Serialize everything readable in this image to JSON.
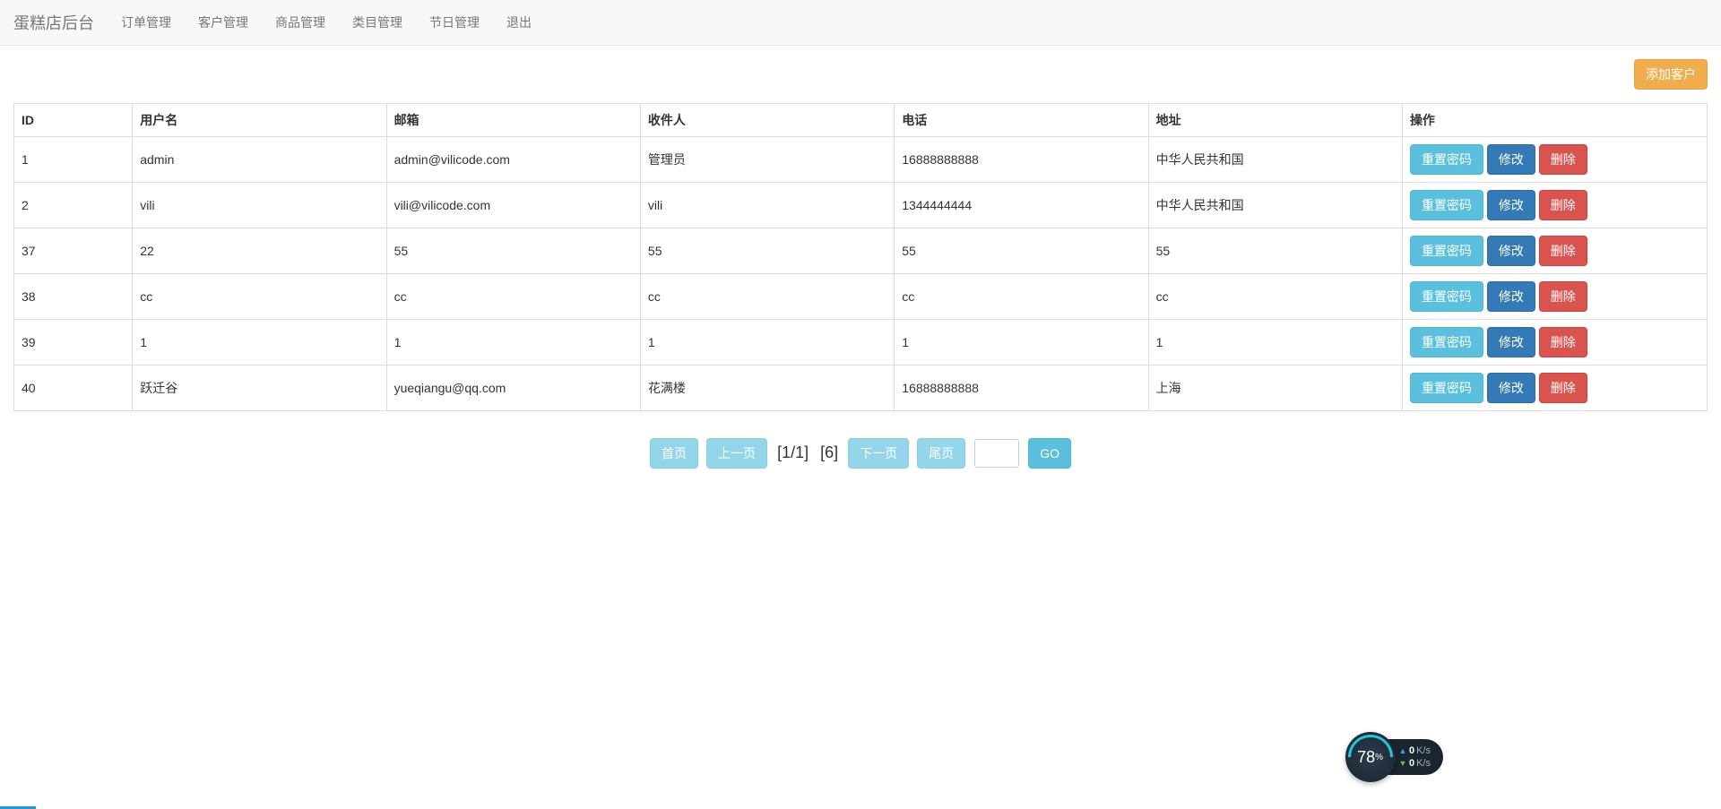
{
  "nav": {
    "brand": "蛋糕店后台",
    "items": [
      {
        "label": "订单管理"
      },
      {
        "label": "客户管理"
      },
      {
        "label": "商品管理"
      },
      {
        "label": "类目管理"
      },
      {
        "label": "节日管理"
      },
      {
        "label": "退出"
      }
    ]
  },
  "toolbar": {
    "add_customer_label": "添加客户"
  },
  "table": {
    "headers": {
      "id": "ID",
      "username": "用户名",
      "email": "邮箱",
      "recipient": "收件人",
      "phone": "电话",
      "address": "地址",
      "operate": "操作"
    },
    "row_actions": {
      "reset_pwd": "重置密码",
      "edit": "修改",
      "delete": "删除"
    },
    "rows": [
      {
        "id": "1",
        "username": "admin",
        "email": "admin@vilicode.com",
        "recipient": "管理员",
        "phone": "16888888888",
        "address": "中华人民共和国"
      },
      {
        "id": "2",
        "username": "vili",
        "email": "vili@vilicode.com",
        "recipient": "vili",
        "phone": "1344444444",
        "address": "中华人民共和国"
      },
      {
        "id": "37",
        "username": "22",
        "email": "55",
        "recipient": "55",
        "phone": "55",
        "address": "55"
      },
      {
        "id": "38",
        "username": "cc",
        "email": "cc",
        "recipient": "cc",
        "phone": "cc",
        "address": "cc"
      },
      {
        "id": "39",
        "username": "1",
        "email": "1",
        "recipient": "1",
        "phone": "1",
        "address": "1"
      },
      {
        "id": "40",
        "username": "跃迁谷",
        "email": "yueqiangu@qq.com",
        "recipient": "花满楼",
        "phone": "16888888888",
        "address": "上海"
      }
    ]
  },
  "pagination": {
    "first": "首页",
    "prev": "上一页",
    "page_text": "[1/1]",
    "total_text": "[6]",
    "next": "下一页",
    "last": "尾页",
    "go": "GO"
  },
  "net_widget": {
    "percent": "78",
    "percent_suffix": "%",
    "up_value": "0",
    "up_unit": "K/s",
    "down_value": "0",
    "down_unit": "K/s"
  }
}
